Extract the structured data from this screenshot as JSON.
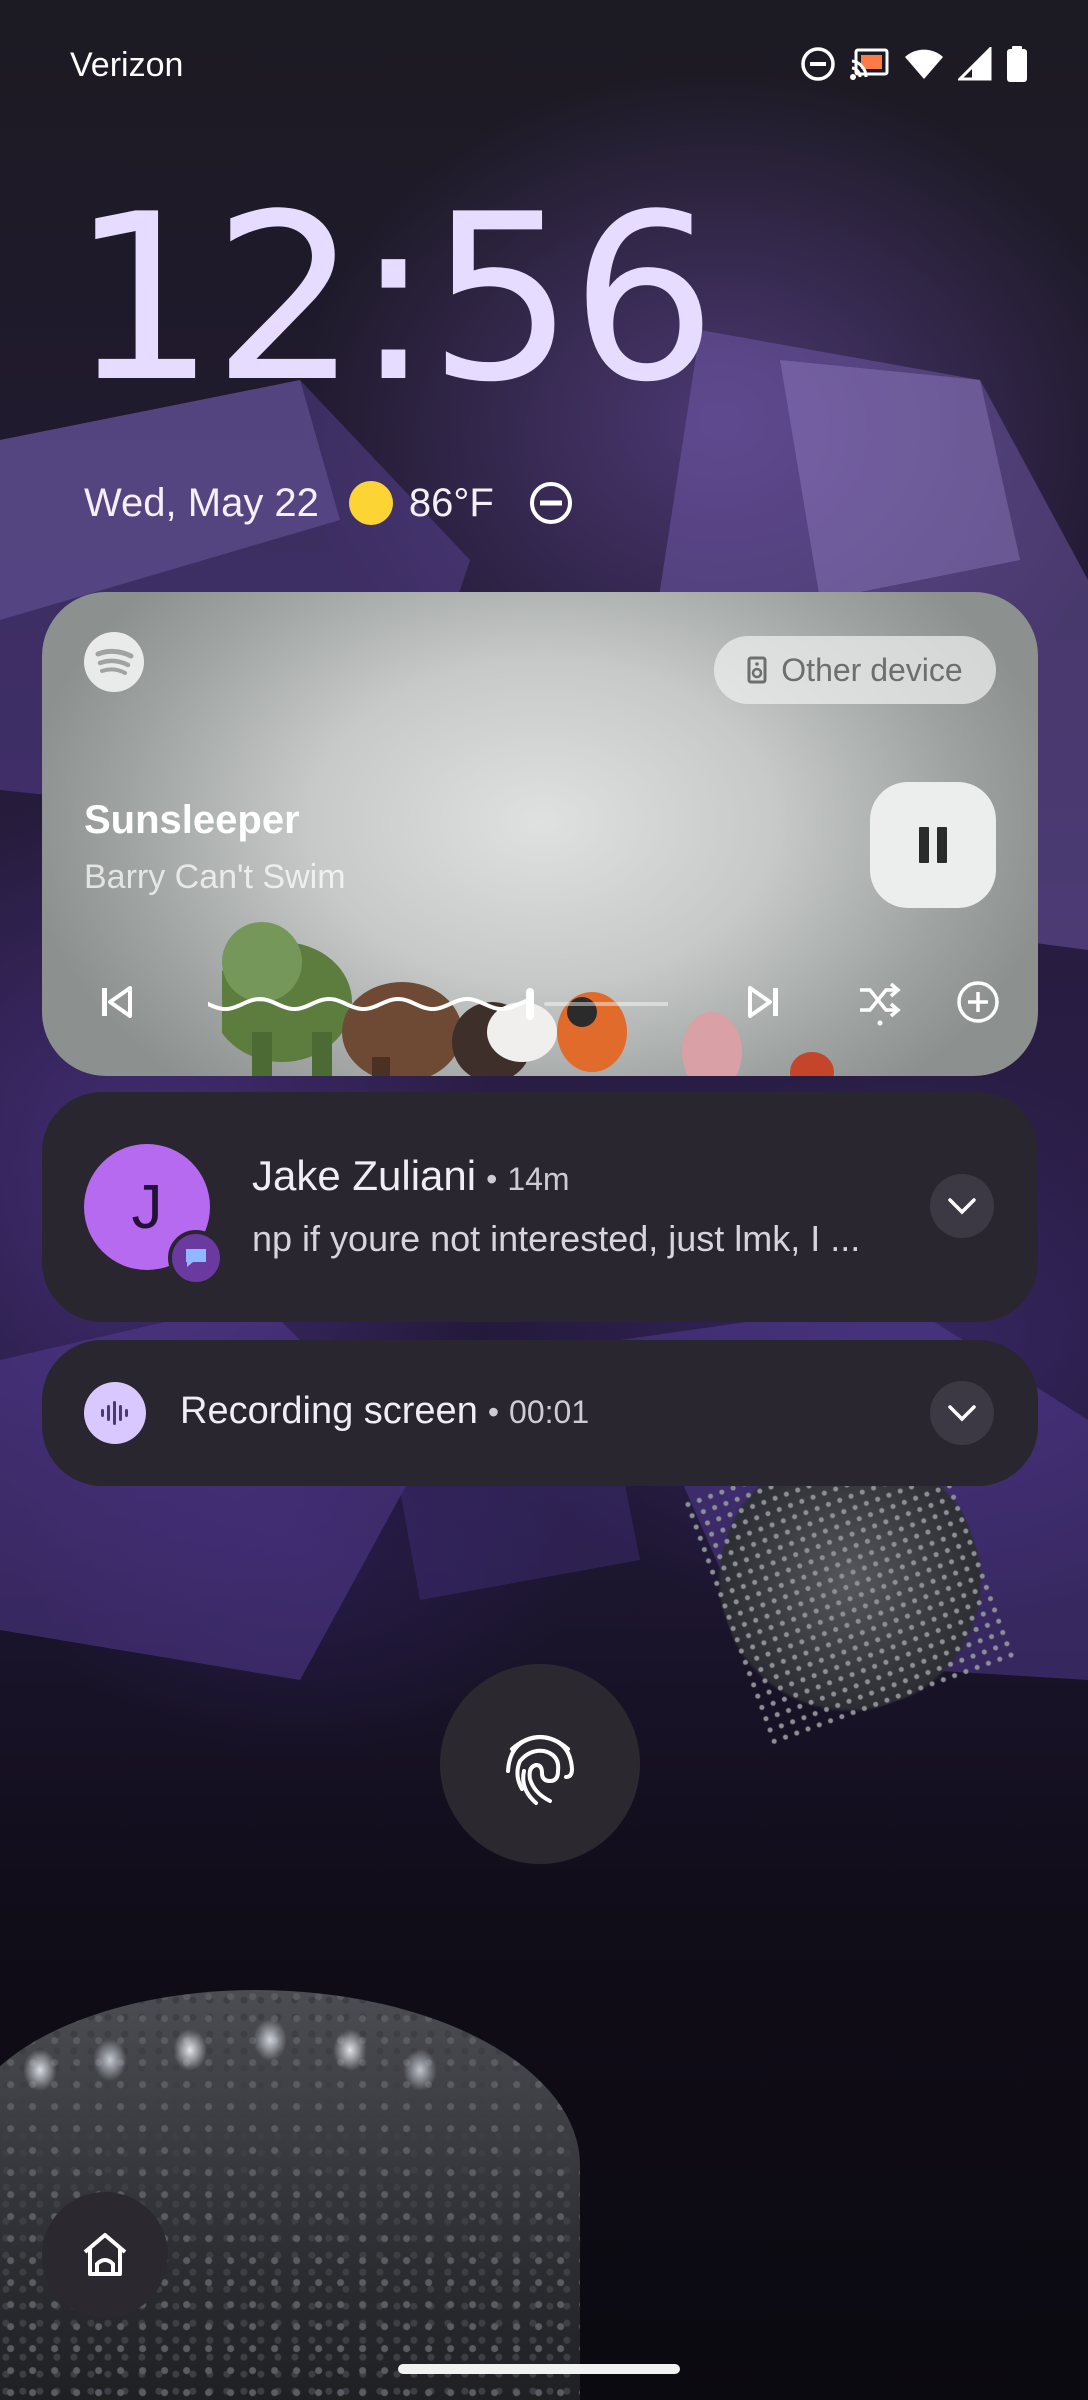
{
  "status_bar": {
    "carrier": "Verizon",
    "icons": [
      "do-not-disturb-icon",
      "cast-icon",
      "wifi-icon",
      "cell-signal-icon",
      "battery-icon"
    ]
  },
  "lockscreen": {
    "time": "12:56",
    "date": "Wed, May 22",
    "temperature": "86°F",
    "weather_icon": "sun-icon"
  },
  "media": {
    "app_icon": "spotify-icon",
    "output_device": "Other device",
    "title": "Sunsleeper",
    "artist": "Barry Can't Swim",
    "playback_state": "playing",
    "progress": 0.7,
    "controls": [
      "previous-icon",
      "next-icon",
      "shuffle-icon",
      "add-icon"
    ]
  },
  "notifications": [
    {
      "sender": "Jake Zuliani",
      "time": "14m",
      "avatar_initial": "J",
      "avatar_color": "#b56af0",
      "message": "np if youre not interested, just lmk, I ..."
    },
    {
      "title": "Recording screen",
      "time": "00:01"
    }
  ],
  "separator": "•"
}
